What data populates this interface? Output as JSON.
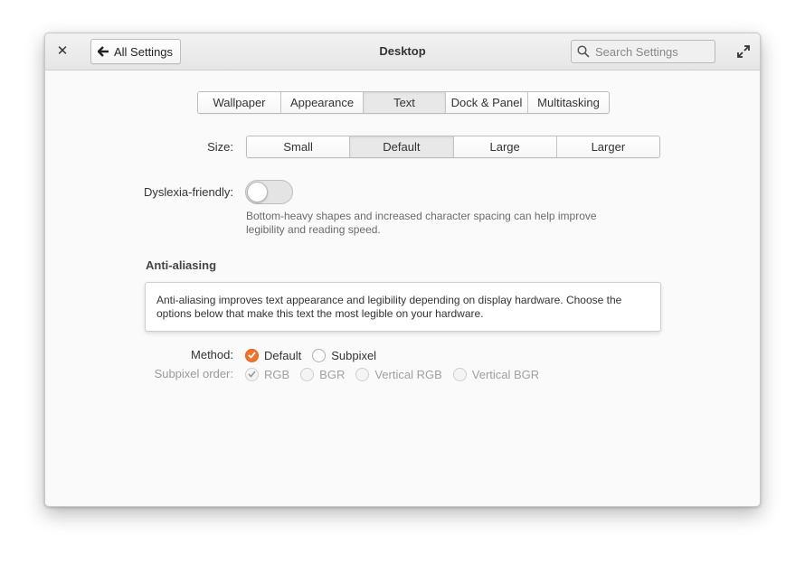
{
  "window": {
    "title": "Desktop",
    "back_label": "All Settings",
    "search_placeholder": "Search Settings"
  },
  "tabs": [
    {
      "label": "Wallpaper",
      "active": false
    },
    {
      "label": "Appearance",
      "active": false
    },
    {
      "label": "Text",
      "active": true
    },
    {
      "label": "Dock & Panel",
      "active": false
    },
    {
      "label": "Multitasking",
      "active": false
    }
  ],
  "size": {
    "label": "Size:",
    "options": [
      "Small",
      "Default",
      "Large",
      "Larger"
    ],
    "selected": "Default"
  },
  "dyslexia": {
    "label": "Dyslexia-friendly:",
    "enabled": false,
    "hint": "Bottom-heavy shapes and increased character spacing can help improve legibility and reading speed."
  },
  "antialiasing": {
    "title": "Anti-aliasing",
    "info": "Anti-aliasing improves text appearance and legibility depending on display hardware. Choose the options below that make this text the most legible on your hardware.",
    "method": {
      "label": "Method:",
      "options": [
        "Default",
        "Subpixel"
      ],
      "selected": "Default"
    },
    "subpixel_order": {
      "label": "Subpixel order:",
      "options": [
        "RGB",
        "BGR",
        "Vertical RGB",
        "Vertical BGR"
      ],
      "selected": "RGB",
      "disabled": true
    }
  },
  "colors": {
    "accent": "#f37329"
  }
}
